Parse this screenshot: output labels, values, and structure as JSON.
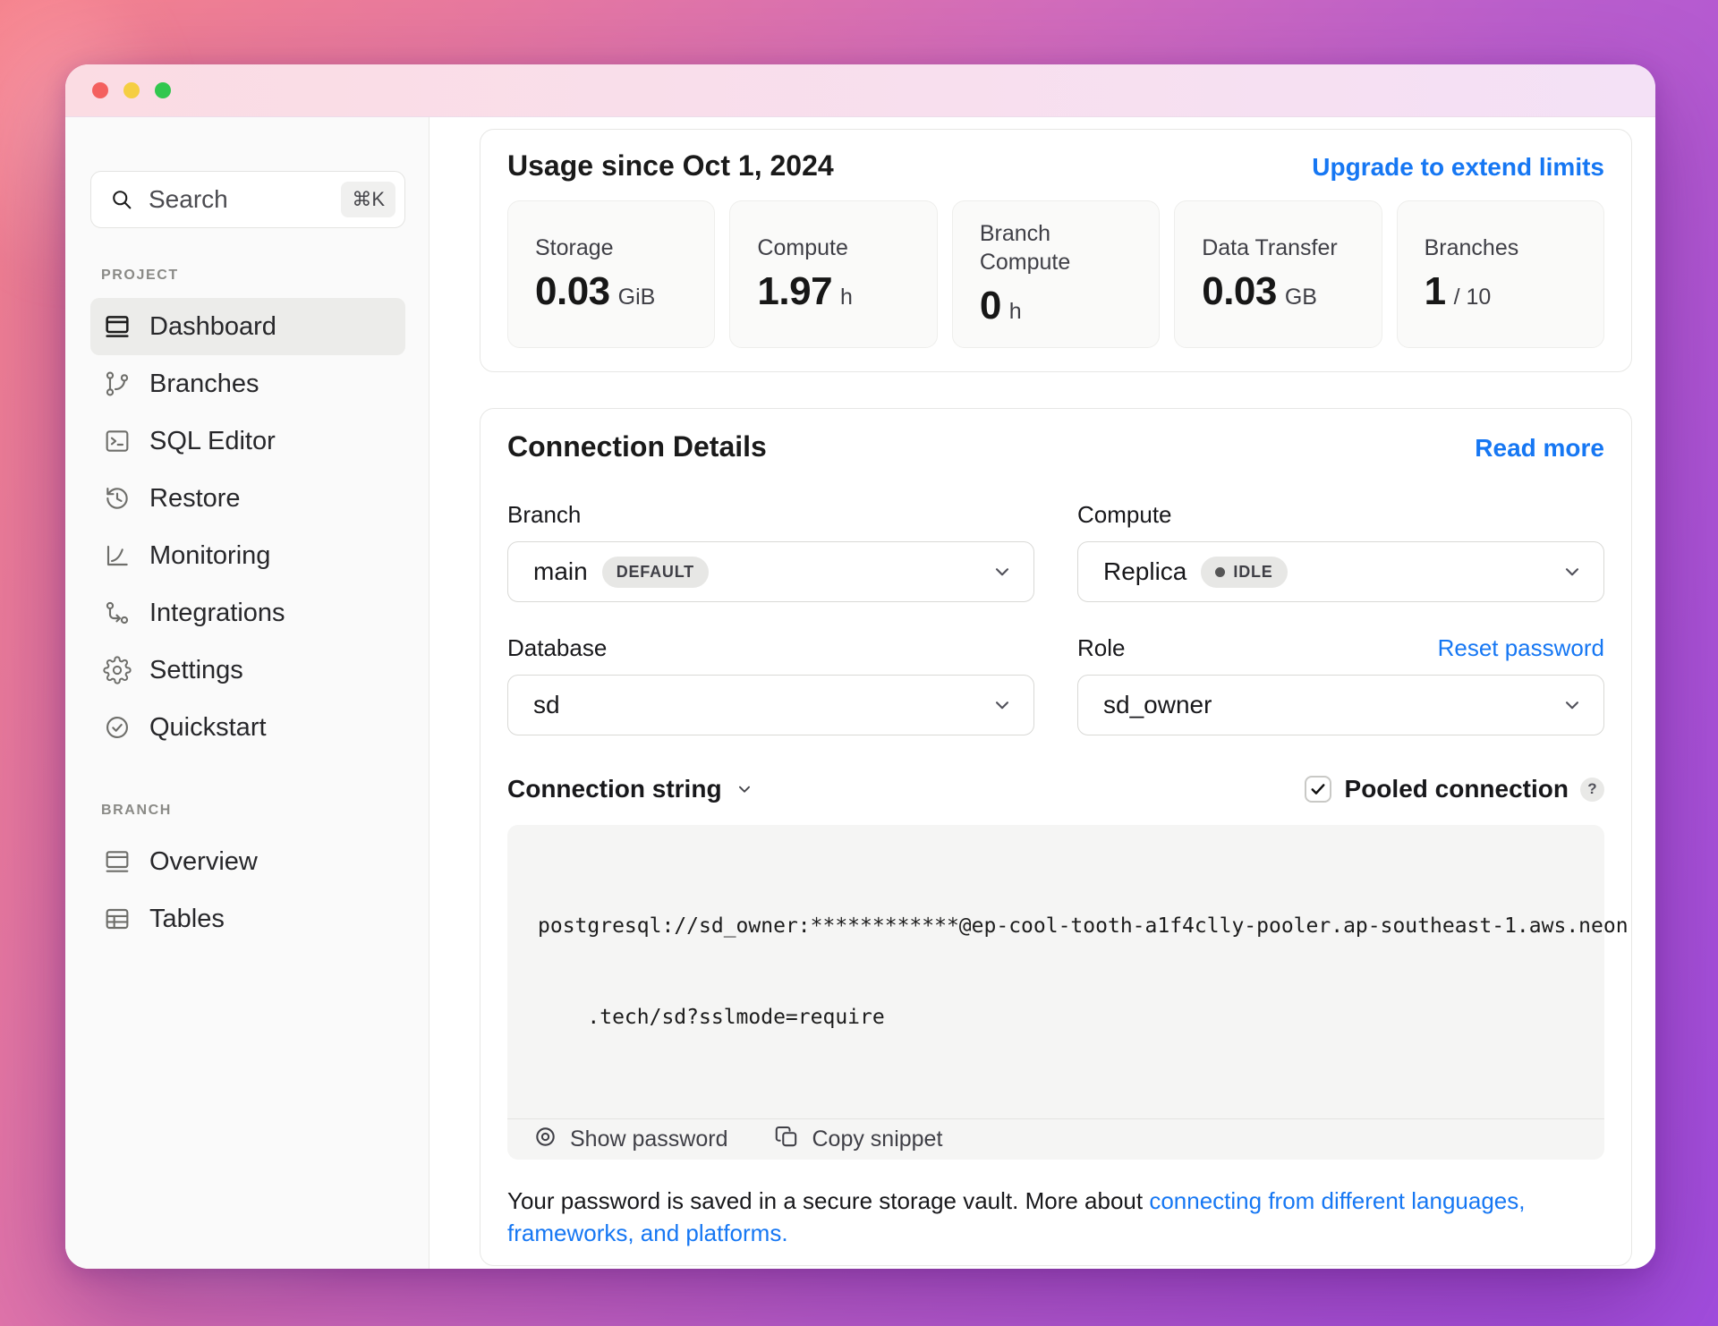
{
  "sidebar": {
    "search": {
      "placeholder": "Search",
      "shortcut": "⌘K"
    },
    "sections": [
      {
        "title": "PROJECT",
        "items": [
          {
            "label": "Dashboard",
            "icon": "dashboard-icon",
            "active": true
          },
          {
            "label": "Branches",
            "icon": "branches-icon",
            "active": false
          },
          {
            "label": "SQL Editor",
            "icon": "sql-editor-icon",
            "active": false
          },
          {
            "label": "Restore",
            "icon": "restore-icon",
            "active": false
          },
          {
            "label": "Monitoring",
            "icon": "monitoring-icon",
            "active": false
          },
          {
            "label": "Integrations",
            "icon": "integrations-icon",
            "active": false
          },
          {
            "label": "Settings",
            "icon": "settings-icon",
            "active": false
          },
          {
            "label": "Quickstart",
            "icon": "quickstart-icon",
            "active": false
          }
        ]
      },
      {
        "title": "BRANCH",
        "items": [
          {
            "label": "Overview",
            "icon": "overview-icon",
            "active": false
          },
          {
            "label": "Tables",
            "icon": "tables-icon",
            "active": false
          }
        ]
      }
    ]
  },
  "usage": {
    "title": "Usage since Oct 1, 2024",
    "upgrade_link": "Upgrade to extend limits",
    "stats": [
      {
        "label": "Storage",
        "value": "0.03",
        "unit": "GiB"
      },
      {
        "label": "Compute",
        "value": "1.97",
        "unit": "h"
      },
      {
        "label": "Branch Compute",
        "value": "0",
        "unit": "h"
      },
      {
        "label": "Data Transfer",
        "value": "0.03",
        "unit": "GB"
      },
      {
        "label": "Branches",
        "value": "1",
        "unit": "/ 10"
      }
    ]
  },
  "connection": {
    "title": "Connection Details",
    "read_more_link": "Read more",
    "fields": {
      "branch": {
        "label": "Branch",
        "value": "main",
        "badge": "DEFAULT"
      },
      "compute": {
        "label": "Compute",
        "value": "Replica",
        "status_badge": "IDLE"
      },
      "database": {
        "label": "Database",
        "value": "sd"
      },
      "role": {
        "label": "Role",
        "value": "sd_owner",
        "reset_link": "Reset password"
      }
    },
    "string_section": {
      "toggle_label": "Connection string",
      "pooled_label": "Pooled connection",
      "pooled_checked": true,
      "help_glyph": "?",
      "code_line1": "postgresql://sd_owner:************@ep-cool-tooth-a1f4clly-pooler.ap-southeast-1.aws.neon",
      "code_line2": ".tech/sd?sslmode=require",
      "show_password_label": "Show password",
      "copy_snippet_label": "Copy snippet"
    },
    "footer": {
      "text": "Your password is saved in a secure storage vault. More about",
      "link": "connecting from different languages, frameworks, and platforms."
    }
  },
  "colors": {
    "accent_blue": "#1677f3",
    "traffic_red": "#f4605f",
    "traffic_yellow": "#f5ce42",
    "traffic_green": "#32c74e",
    "badge_bg": "#e7e7e5",
    "idle_dot": "#565656",
    "sidebar_bg": "#fafafa",
    "code_bg": "#f5f5f4"
  }
}
